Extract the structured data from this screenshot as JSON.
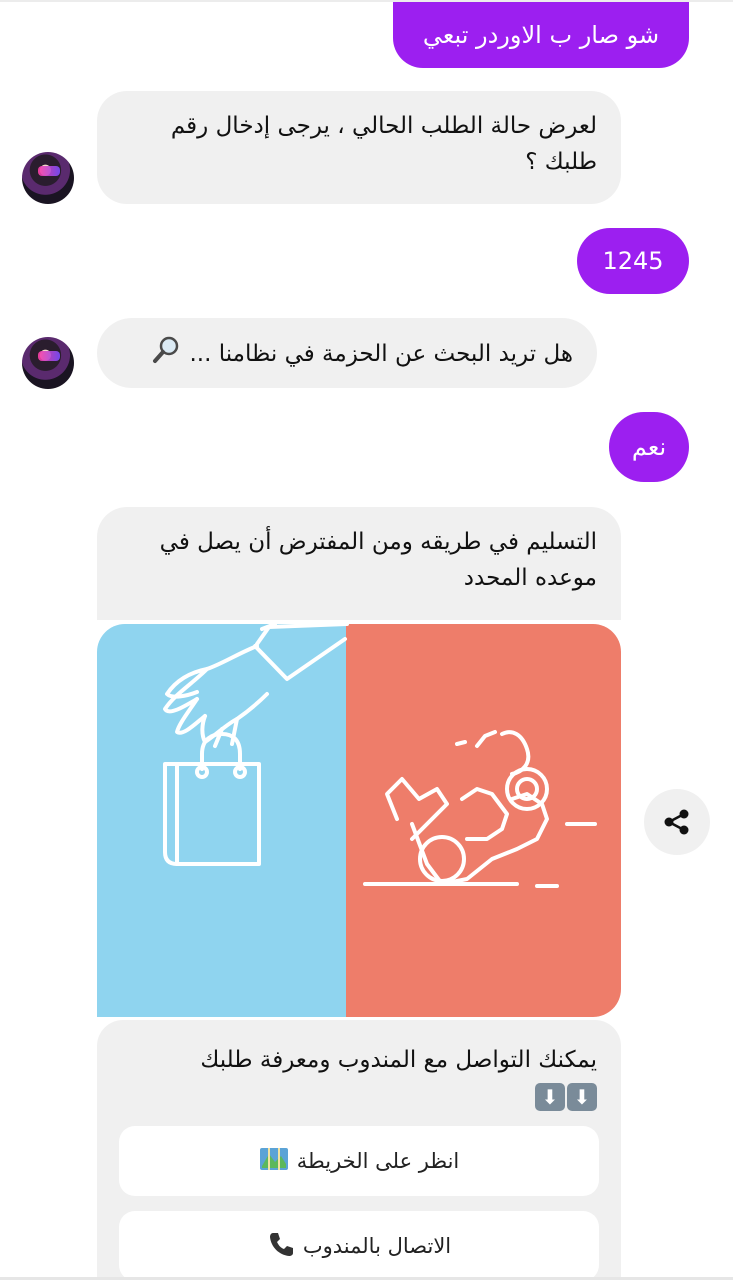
{
  "messages": {
    "user_1": "شو صار ب الاوردر تبعي",
    "bot_1": "لعرض حالة الطلب الحالي ، يرجى إدخال رقم طلبك ؟",
    "user_2": "1245",
    "bot_2": "هل تريد البحث عن الحزمة في نظامنا ...",
    "user_3": "نعم",
    "bot_3": "التسليم في طريقه ومن المفترض أن يصل في موعده المحدد"
  },
  "card": {
    "text": "يمكنك التواصل مع المندوب ومعرفة طلبك",
    "arrow_glyph": "⬇",
    "buttons": [
      {
        "label": "انظر على الخريطة",
        "icon": "map-icon"
      },
      {
        "label": "الاتصال بالمندوب",
        "icon": "phone-icon"
      }
    ]
  },
  "icons": {
    "bot_2_suffix": "magnifier-icon",
    "share": "share-icon",
    "avatar": "bot-avatar"
  },
  "colors": {
    "user_bubble": "#9c1ff0",
    "bot_bubble": "#f0f0f0",
    "image_left": "#8fd4ef",
    "image_right": "#ee7d6a"
  }
}
